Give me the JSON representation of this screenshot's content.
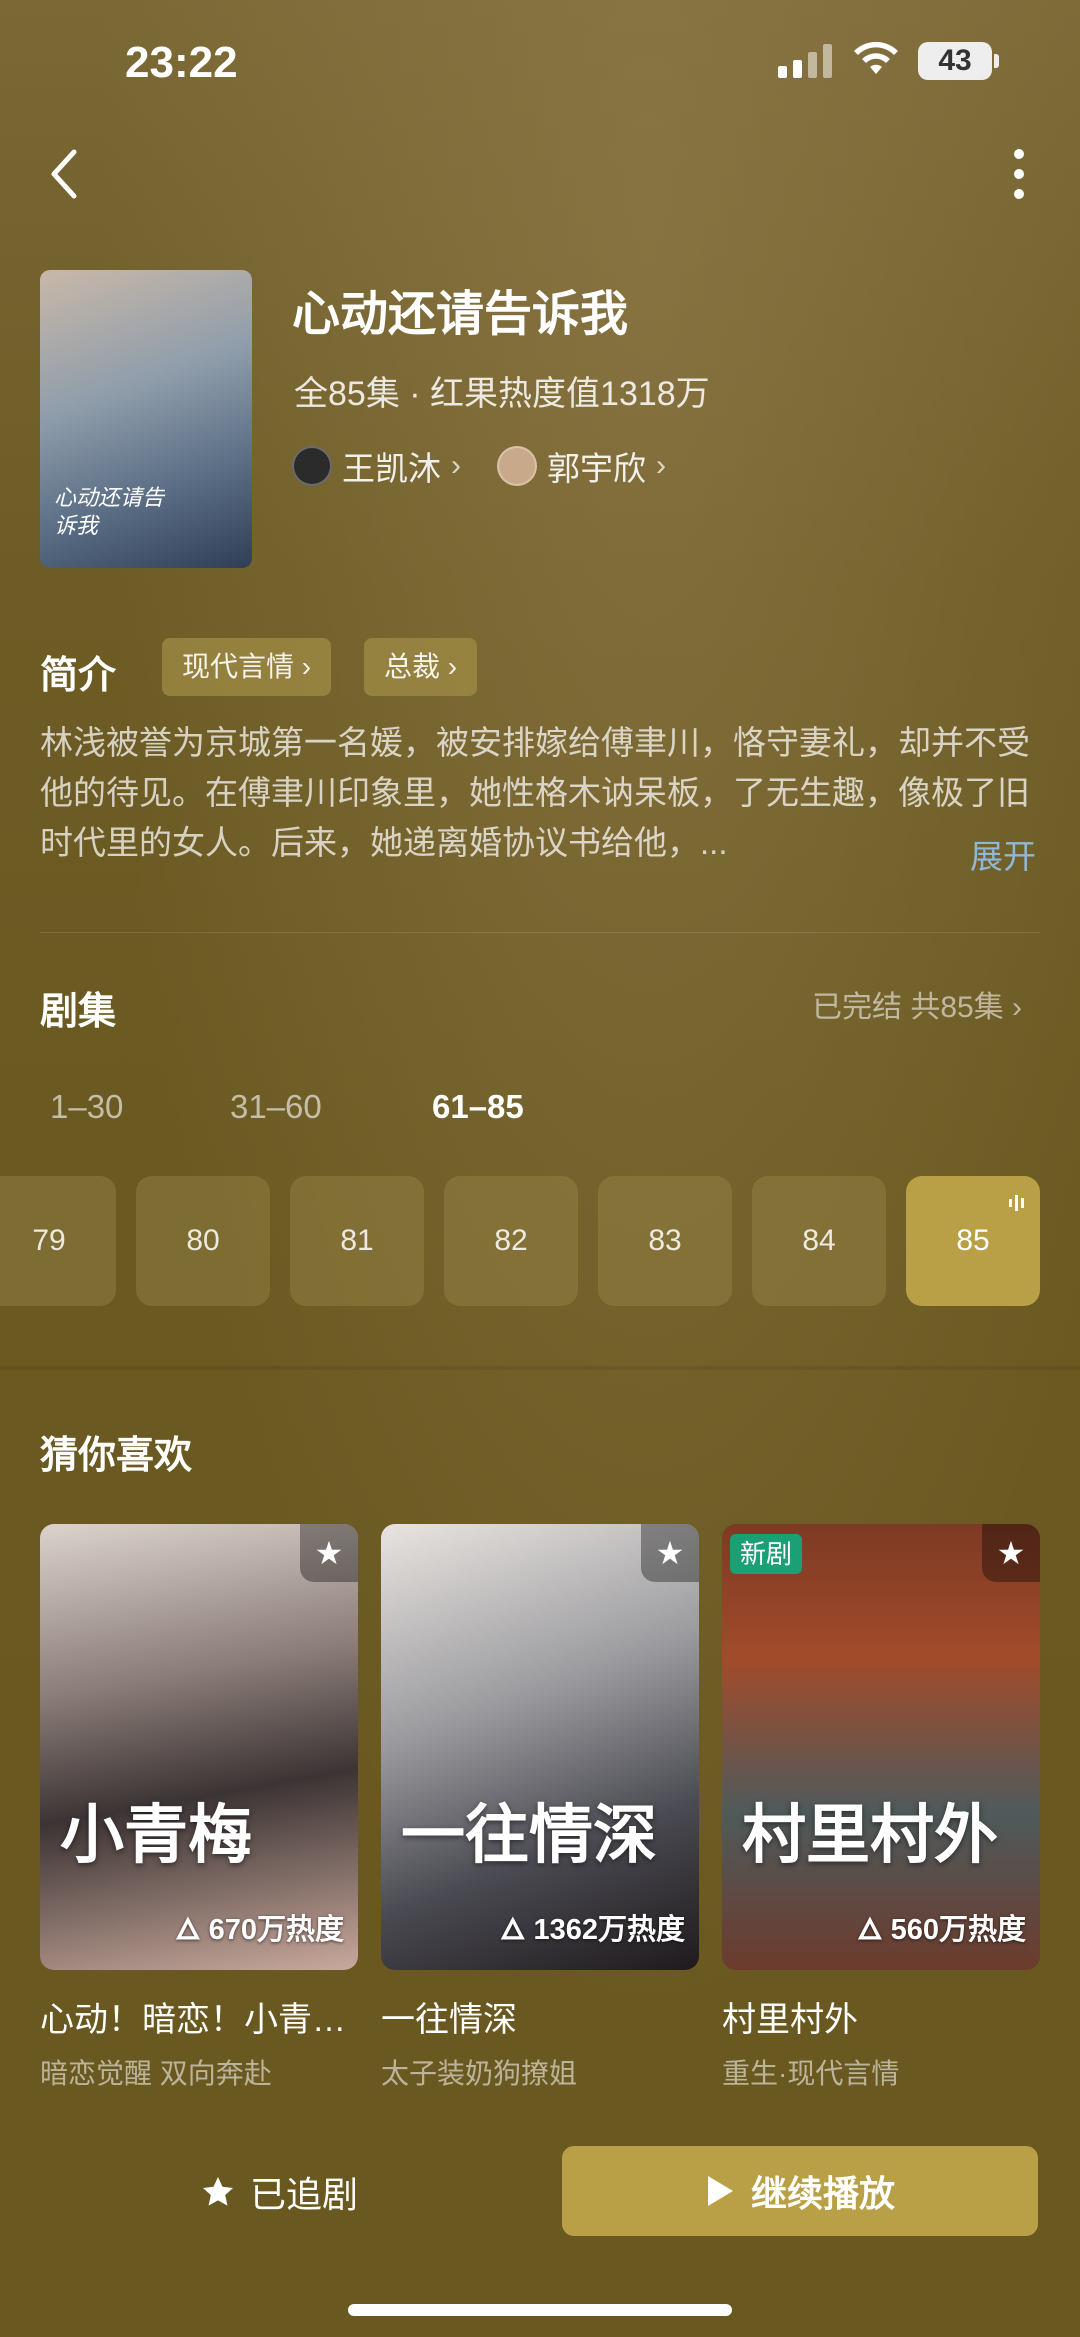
{
  "status_bar": {
    "time": "23:22",
    "battery": "43"
  },
  "show": {
    "title": "心动还请告诉我",
    "meta": "全85集 · 红果热度值1318万",
    "poster_text": "心动还请告诉我",
    "actors": [
      {
        "name": "王凯沐"
      },
      {
        "name": "郭宇欣"
      }
    ]
  },
  "intro": {
    "heading": "简介",
    "tags": [
      "现代言情",
      "总裁"
    ],
    "text": "林浅被誉为京城第一名媛，被安排嫁给傅聿川，恪守妻礼，却并不受他的待见。在傅聿川印象里，她性格木讷呆板，了无生趣，像极了旧时代里的女人。后来，她递离婚协议书给他，...",
    "expand_label": "展开"
  },
  "episodes": {
    "heading": "剧集",
    "status": "已完结 共85集",
    "ranges": [
      "1–30",
      "31–60",
      "61–85"
    ],
    "active_range": "61–85",
    "items": [
      "79",
      "80",
      "81",
      "82",
      "83",
      "84",
      "85"
    ],
    "current": "85"
  },
  "recommend": {
    "heading": "猜你喜欢",
    "items": [
      {
        "name": "心动！暗恋！小青…",
        "sub": "暗恋觉醒 双向奔赴",
        "heat": "670万热度",
        "poster_text": "小青梅",
        "new": ""
      },
      {
        "name": "一往情深",
        "sub": "太子装奶狗撩姐",
        "heat": "1362万热度",
        "poster_text": "一往情深",
        "new": ""
      },
      {
        "name": "村里村外",
        "sub": "重生·现代言情",
        "heat": "560万热度",
        "poster_text": "村里村外",
        "new": "新剧"
      }
    ]
  },
  "bottom": {
    "follow_label": "已追剧",
    "play_label": "继续播放"
  },
  "colors": {
    "accent": "#b9a046",
    "background": "#6b5a22",
    "link": "#8fb8d6",
    "new_badge": "#1aa074"
  },
  "icons": [
    "back-icon",
    "more-icon",
    "star-icon",
    "play-icon",
    "signal-icon",
    "wifi-icon",
    "battery-icon",
    "playing-bars-icon"
  ]
}
